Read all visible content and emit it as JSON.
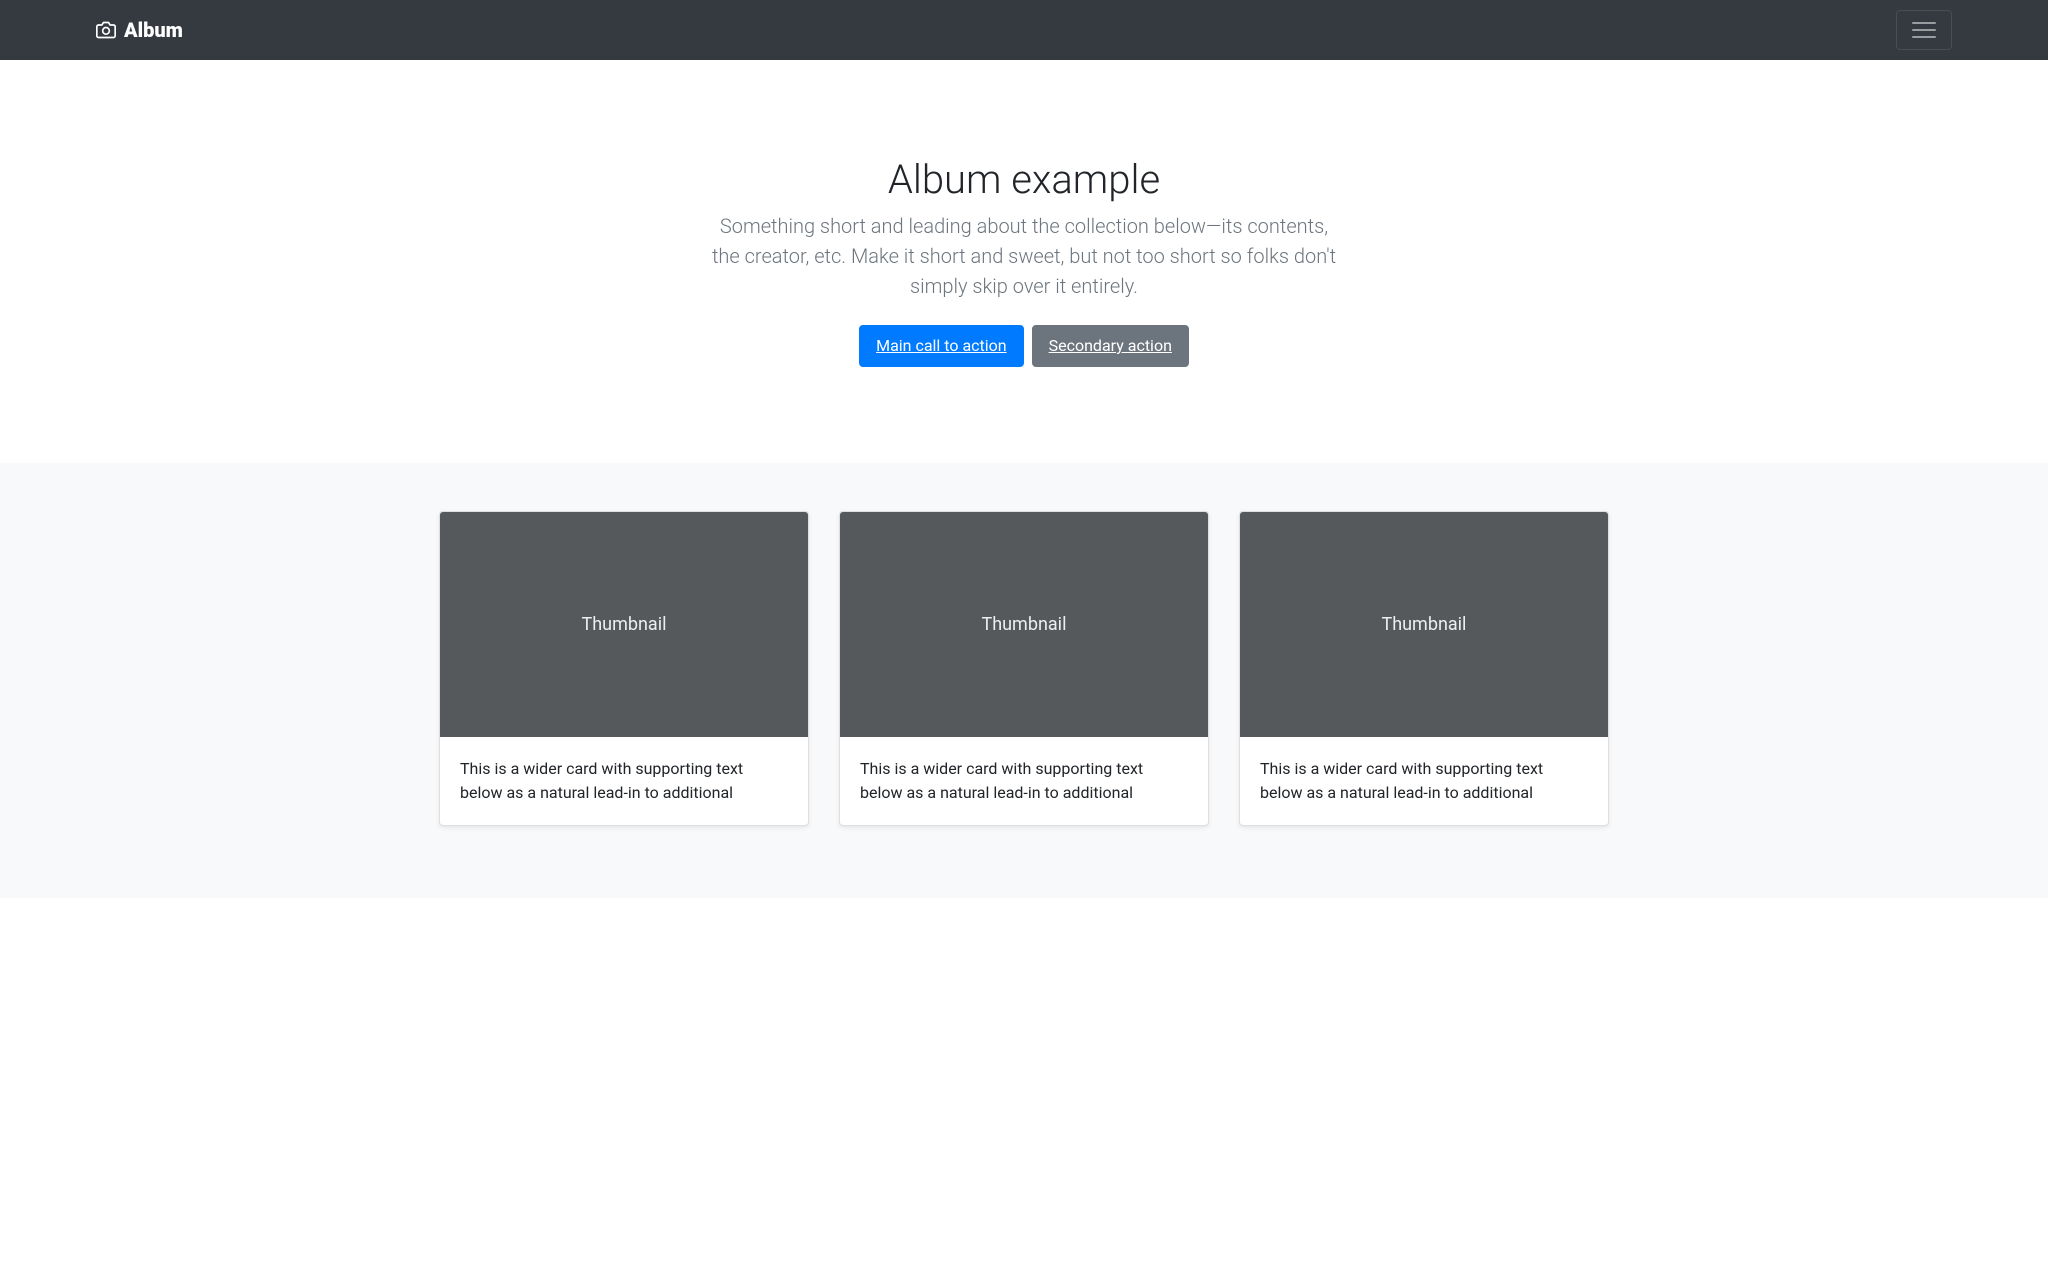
{
  "navbar": {
    "brand": "Album"
  },
  "hero": {
    "title": "Album example",
    "lead": "Something short and leading about the collection below—its contents, the creator, etc. Make it short and sweet, but not too short so folks don't simply skip over it entirely.",
    "primary_button": "Main call to action",
    "secondary_button": "Secondary action"
  },
  "cards": [
    {
      "thumbnail_label": "Thumbnail",
      "text": "This is a wider card with supporting text below as a natural lead-in to additional"
    },
    {
      "thumbnail_label": "Thumbnail",
      "text": "This is a wider card with supporting text below as a natural lead-in to additional"
    },
    {
      "thumbnail_label": "Thumbnail",
      "text": "This is a wider card with supporting text below as a natural lead-in to additional"
    }
  ]
}
